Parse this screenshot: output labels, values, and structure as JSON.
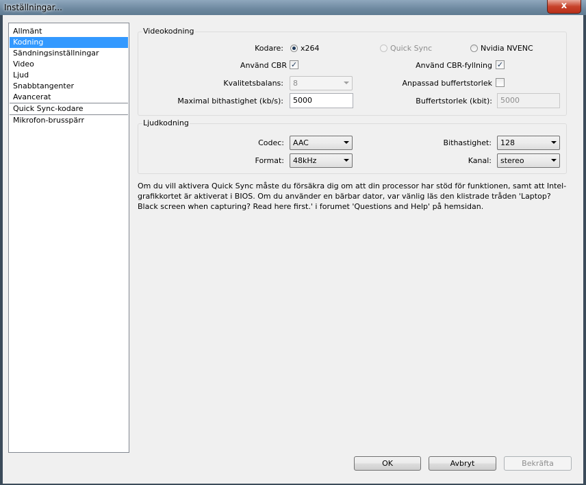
{
  "window": {
    "title": "Inställningar...",
    "close_glyph": "x"
  },
  "nav": {
    "items": [
      {
        "label": "Allmänt"
      },
      {
        "label": "Kodning"
      },
      {
        "label": "Sändningsinställningar"
      },
      {
        "label": "Video"
      },
      {
        "label": "Ljud"
      },
      {
        "label": "Snabbtangenter"
      },
      {
        "label": "Avancerat"
      },
      {
        "label": "Quick Sync-kodare"
      },
      {
        "label": "Mikrofon-brusspärr"
      }
    ],
    "selected": "Kodning"
  },
  "video": {
    "group_label": "Videokodning",
    "encoder_label": "Kodare:",
    "encoder_options": [
      "x264",
      "Quick Sync",
      "Nvidia NVENC"
    ],
    "encoder_selected": "x264",
    "cbr_label": "Använd CBR",
    "cbr_checked": true,
    "cbr_fill_label": "Använd CBR-fyllning",
    "cbr_fill_checked": true,
    "quality_label": "Kvalitetsbalans:",
    "quality_value": "8",
    "custom_buffer_label": "Anpassad buffertstorlek",
    "custom_buffer_checked": false,
    "max_bitrate_label": "Maximal bithastighet (kb/s):",
    "max_bitrate_value": "5000",
    "buffer_size_label": "Buffertstorlek (kbit):",
    "buffer_size_value": "5000",
    "check_glyph": "✓"
  },
  "audio": {
    "group_label": "Ljudkodning",
    "codec_label": "Codec:",
    "codec_value": "AAC",
    "bitrate_label": "Bithastighet:",
    "bitrate_value": "128",
    "format_label": "Format:",
    "format_value": "48kHz",
    "channel_label": "Kanal:",
    "channel_value": "stereo"
  },
  "note": "Om du vill aktivera Quick Sync måste du försäkra dig om att din processor har stöd för funktionen, samt att Intel-grafikkortet är aktiverat i BIOS. Om du använder en bärbar dator, var vänlig läs den klistrade tråden 'Laptop? Black screen when capturing? Read here first.' i forumet 'Questions and Help' på hemsidan.",
  "buttons": {
    "ok": "OK",
    "cancel": "Avbryt",
    "apply": "Bekräfta"
  }
}
